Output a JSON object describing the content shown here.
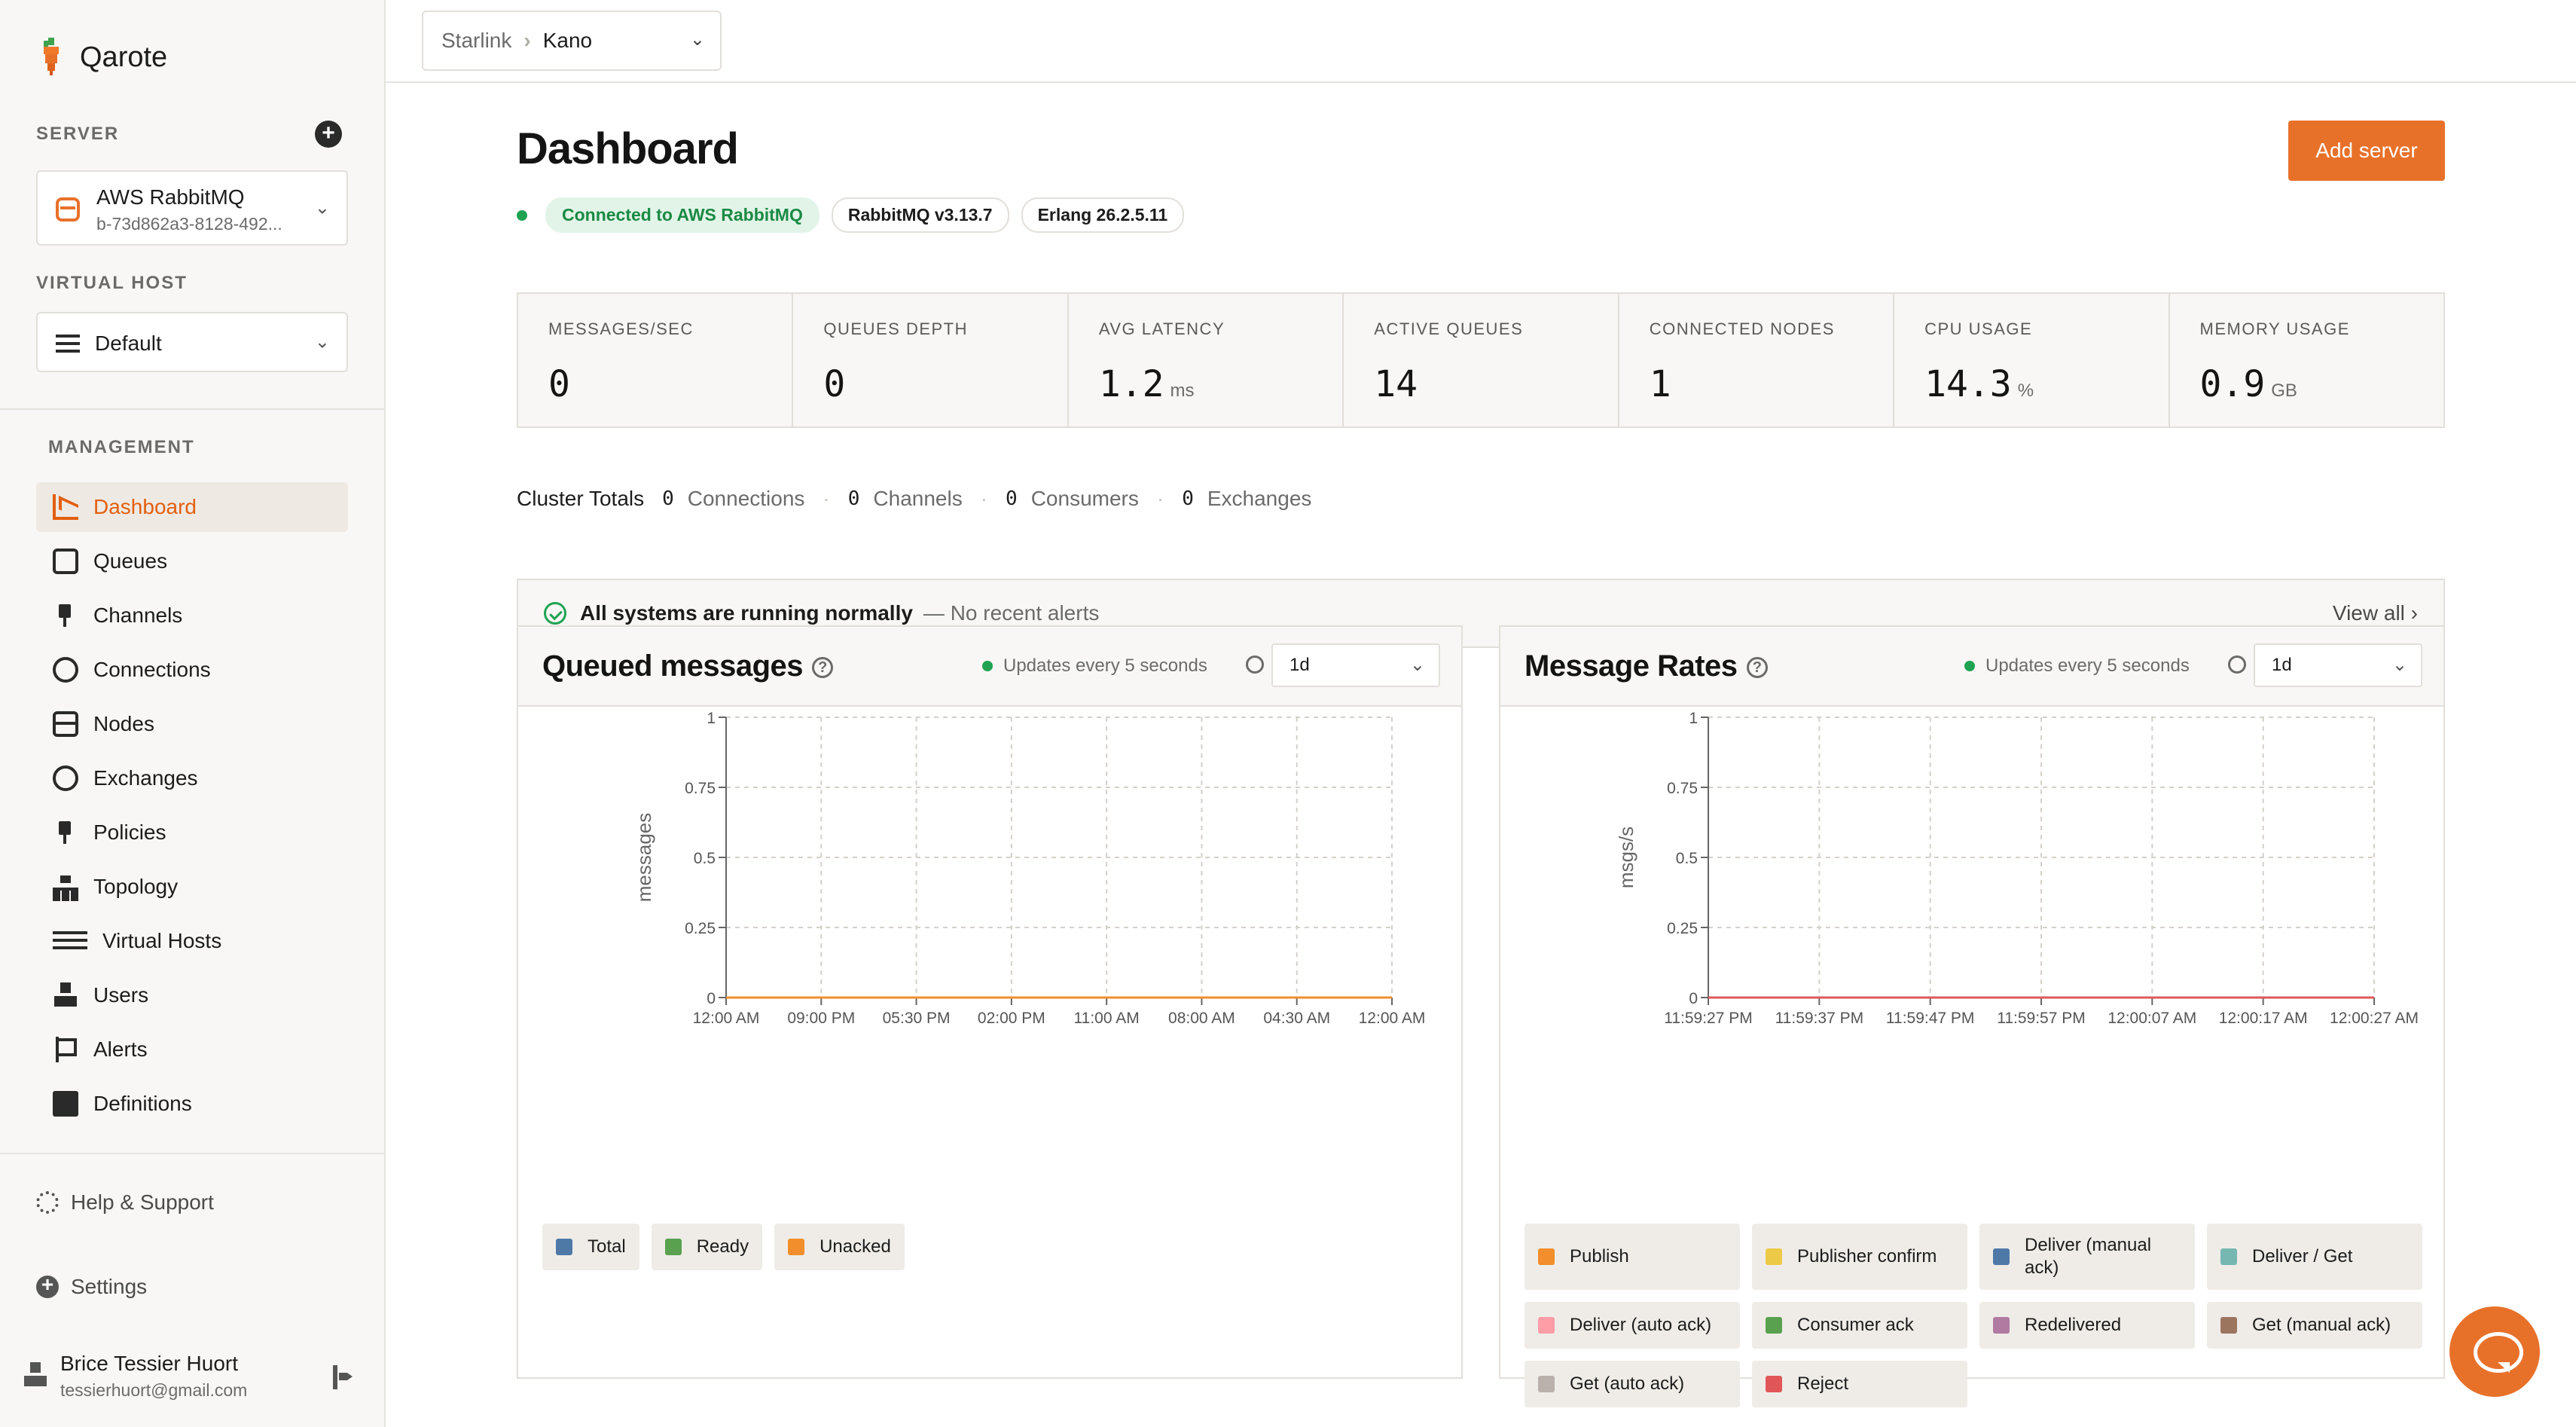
{
  "app": {
    "name": "Qarote",
    "accent": "#e8712a"
  },
  "sidebar": {
    "server_label": "SERVER",
    "server": {
      "name": "AWS RabbitMQ",
      "id": "b-73d862a3-8128-492..."
    },
    "vhost_label": "VIRTUAL HOST",
    "vhost": "Default",
    "management_label": "MANAGEMENT",
    "items": [
      {
        "label": "Dashboard",
        "icon": "chart-icon",
        "active": true
      },
      {
        "label": "Queues",
        "icon": "queue-icon"
      },
      {
        "label": "Channels",
        "icon": "plug-icon"
      },
      {
        "label": "Connections",
        "icon": "connection-icon"
      },
      {
        "label": "Nodes",
        "icon": "server-icon"
      },
      {
        "label": "Exchanges",
        "icon": "exchange-icon"
      },
      {
        "label": "Policies",
        "icon": "policy-icon"
      },
      {
        "label": "Topology",
        "icon": "topology-icon"
      },
      {
        "label": "Virtual Hosts",
        "icon": "list-icon"
      },
      {
        "label": "Users",
        "icon": "user-icon"
      },
      {
        "label": "Alerts",
        "icon": "flag-icon"
      },
      {
        "label": "Definitions",
        "icon": "chip-icon"
      }
    ],
    "help": "Help & Support",
    "settings": "Settings",
    "user": {
      "name": "Brice Tessier Huort",
      "email": "tessierhuort@gmail.com"
    }
  },
  "topbar": {
    "workspace": "Starlink",
    "project": "Kano"
  },
  "main": {
    "title": "Dashboard",
    "add_server": "Add server",
    "badges": {
      "connected": "Connected to AWS RabbitMQ",
      "rabbit": "RabbitMQ v3.13.7",
      "erlang": "Erlang 26.2.5.11"
    },
    "stats": [
      {
        "label": "MESSAGES/SEC",
        "value": "0",
        "unit": ""
      },
      {
        "label": "QUEUES DEPTH",
        "value": "0",
        "unit": ""
      },
      {
        "label": "AVG LATENCY",
        "value": "1.2",
        "unit": "ms"
      },
      {
        "label": "ACTIVE QUEUES",
        "value": "14",
        "unit": ""
      },
      {
        "label": "CONNECTED NODES",
        "value": "1",
        "unit": ""
      },
      {
        "label": "CPU USAGE",
        "value": "14.3",
        "unit": "%"
      },
      {
        "label": "MEMORY USAGE",
        "value": "0.9",
        "unit": "GB"
      }
    ],
    "totals": {
      "label": "Cluster Totals",
      "items": [
        {
          "value": "0",
          "label": "Connections"
        },
        {
          "value": "0",
          "label": "Channels"
        },
        {
          "value": "0",
          "label": "Consumers"
        },
        {
          "value": "0",
          "label": "Exchanges"
        }
      ]
    },
    "alert": {
      "main": "All systems are running normally",
      "sub": "— No recent alerts",
      "view_all": "View all"
    }
  },
  "panels": {
    "queued": {
      "title": "Queued messages",
      "updates": "Updates every 5 seconds",
      "range": "1d"
    },
    "rates": {
      "title": "Message Rates",
      "updates": "Updates every 5 seconds",
      "range": "1d"
    }
  },
  "chart_data": [
    {
      "type": "line",
      "ylabel": "messages",
      "ylim": [
        0,
        1
      ],
      "yticks": [
        "0",
        "0.25",
        "0.5",
        "0.75",
        "1"
      ],
      "x": [
        "12:00 AM",
        "09:00 PM",
        "05:30 PM",
        "02:00 PM",
        "11:00 AM",
        "08:00 AM",
        "04:30 AM",
        "12:00 AM"
      ],
      "grid": true,
      "legend_position": "bottom",
      "series": [
        {
          "name": "Total",
          "color": "#4e79a7",
          "values": [
            0,
            0,
            0,
            0,
            0,
            0,
            0,
            0
          ]
        },
        {
          "name": "Ready",
          "color": "#59a14f",
          "values": [
            0,
            0,
            0,
            0,
            0,
            0,
            0,
            0
          ]
        },
        {
          "name": "Unacked",
          "color": "#f28e2b",
          "values": [
            0,
            0,
            0,
            0,
            0,
            0,
            0,
            0
          ]
        }
      ]
    },
    {
      "type": "line",
      "ylabel": "msgs/s",
      "ylim": [
        0,
        1
      ],
      "yticks": [
        "0",
        "0.25",
        "0.5",
        "0.75",
        "1"
      ],
      "x": [
        "11:59:27 PM",
        "11:59:37 PM",
        "11:59:47 PM",
        "11:59:57 PM",
        "12:00:07 AM",
        "12:00:17 AM",
        "12:00:27 AM"
      ],
      "grid": true,
      "legend_position": "bottom",
      "series": [
        {
          "name": "Publish",
          "color": "#f28e2b",
          "values": [
            0,
            0,
            0,
            0,
            0,
            0,
            0
          ]
        },
        {
          "name": "Publisher confirm",
          "color": "#edc948",
          "values": [
            0,
            0,
            0,
            0,
            0,
            0,
            0
          ]
        },
        {
          "name": "Deliver (manual ack)",
          "color": "#4e79a7",
          "values": [
            0,
            0,
            0,
            0,
            0,
            0,
            0
          ]
        },
        {
          "name": "Deliver / Get",
          "color": "#76b7b2",
          "values": [
            0,
            0,
            0,
            0,
            0,
            0,
            0
          ]
        },
        {
          "name": "Deliver (auto ack)",
          "color": "#ff9da7",
          "values": [
            0,
            0,
            0,
            0,
            0,
            0,
            0
          ]
        },
        {
          "name": "Consumer ack",
          "color": "#59a14f",
          "values": [
            0,
            0,
            0,
            0,
            0,
            0,
            0
          ]
        },
        {
          "name": "Redelivered",
          "color": "#b07aa1",
          "values": [
            0,
            0,
            0,
            0,
            0,
            0,
            0
          ]
        },
        {
          "name": "Get (manual ack)",
          "color": "#9c755f",
          "values": [
            0,
            0,
            0,
            0,
            0,
            0,
            0
          ]
        },
        {
          "name": "Get (auto ack)",
          "color": "#bab0ac",
          "values": [
            0,
            0,
            0,
            0,
            0,
            0,
            0
          ]
        },
        {
          "name": "Reject",
          "color": "#e15759",
          "values": [
            0,
            0,
            0,
            0,
            0,
            0,
            0
          ]
        }
      ]
    }
  ]
}
